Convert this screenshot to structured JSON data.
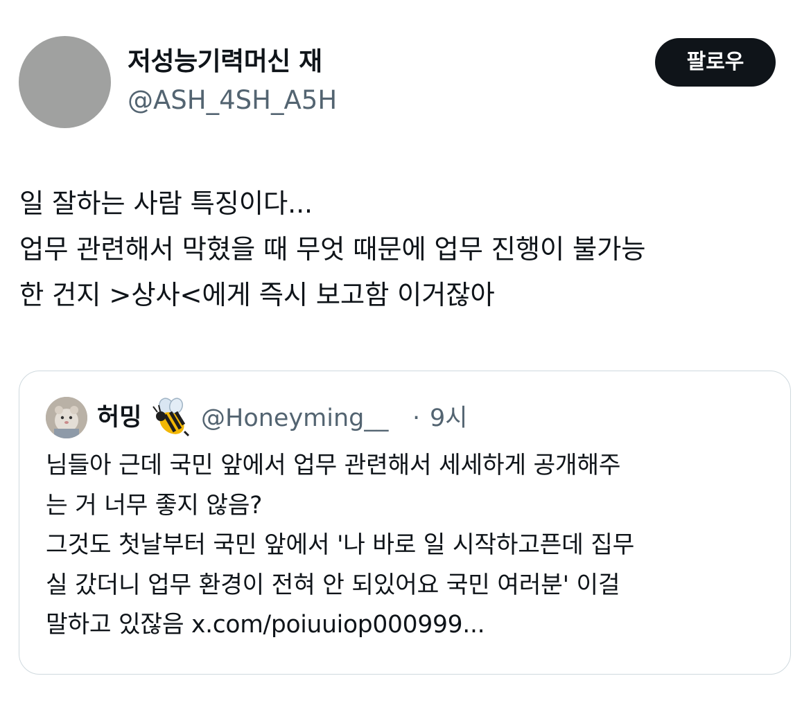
{
  "author": {
    "display_name": "저성능기력머신 재",
    "handle": "@ASH_4SH_A5H",
    "avatar_color": "#a0a1a0"
  },
  "follow_button": {
    "label": "팔로우"
  },
  "tweet": {
    "lines": [
      "일 잘하는 사람 특징이다...",
      "업무 관련해서 막혔을 때 무엇 때문에 업무 진행이 불가능",
      "한 건지 >상사<에게 즉시 보고함 이거잖아"
    ]
  },
  "quoted_tweet": {
    "display_name": "허밍",
    "emoji_icon": "bee-icon",
    "handle": "@Honeyming__",
    "separator": "·",
    "time": "9시",
    "lines": [
      "님들아 근데 국민 앞에서 업무 관련해서 세세하게 공개해주",
      "는 거 너무 좋지 않음?",
      "그것도 첫날부터 국민 앞에서 '나 바로 일 시작하고픈데 집무",
      "실 갔더니 업무 환경이 전혀 안 되있어요 국민 여러분' 이걸",
      "말하고 있잖음 x.com/poiuuiop000999..."
    ]
  },
  "colors": {
    "text": "#0f1419",
    "secondary_text": "#536471",
    "border": "#cfd9de",
    "button_bg": "#0f1419",
    "button_text": "#ffffff"
  }
}
